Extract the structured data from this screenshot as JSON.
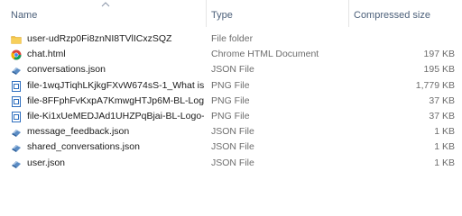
{
  "columns": {
    "name": "Name",
    "type": "Type",
    "size": "Compressed size"
  },
  "sort": {
    "column": "name",
    "direction": "ascending",
    "icon": "chevron-up-icon"
  },
  "files": [
    {
      "name": "user-udRzp0Fi8znNI8TVlICxzSQZ",
      "type": "File folder",
      "size": "",
      "icon": "folder-icon"
    },
    {
      "name": "chat.html",
      "type": "Chrome HTML Document",
      "size": "197 KB",
      "icon": "chrome-icon"
    },
    {
      "name": "conversations.json",
      "type": "JSON File",
      "size": "195 KB",
      "icon": "json-file-icon"
    },
    {
      "name": "file-1wqJTiqhLKjkgFXvW674sS-1_What is...",
      "type": "PNG File",
      "size": "1,779 KB",
      "icon": "image-file-icon"
    },
    {
      "name": "file-8FFphFvKxpA7KmwgHTJp6M-BL-Log...",
      "type": "PNG File",
      "size": "37 KB",
      "icon": "image-file-icon"
    },
    {
      "name": "file-Ki1xUeMEDJAd1UHZPqBjai-BL-Logo-...",
      "type": "PNG File",
      "size": "37 KB",
      "icon": "image-file-icon"
    },
    {
      "name": "message_feedback.json",
      "type": "JSON File",
      "size": "1 KB",
      "icon": "json-file-icon"
    },
    {
      "name": "shared_conversations.json",
      "type": "JSON File",
      "size": "1 KB",
      "icon": "json-file-icon"
    },
    {
      "name": "user.json",
      "type": "JSON File",
      "size": "1 KB",
      "icon": "json-file-icon"
    }
  ],
  "colors": {
    "folder": "#f2c043",
    "json": "#4a7fb6",
    "png": "#2f6fbf",
    "header_text": "#4c607a",
    "secondary_text": "#6d6d6d"
  }
}
